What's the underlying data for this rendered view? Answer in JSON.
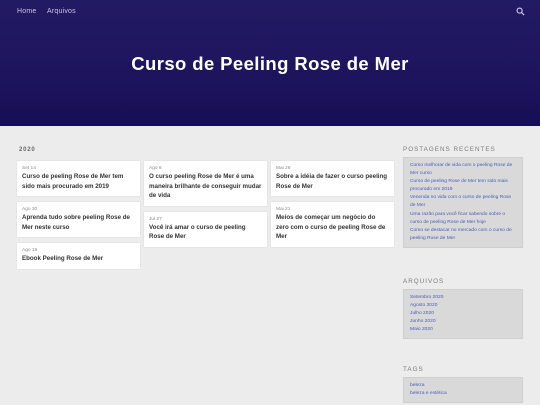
{
  "nav": {
    "home": "Home",
    "archives": "Arquivos",
    "search_icon": "search-icon"
  },
  "hero": {
    "title": "Curso de Peeling Rose de Mer"
  },
  "main": {
    "year": "2020",
    "columns": [
      [
        {
          "date": "Set 14",
          "title": "Curso de peeling Rose de Mer tem sido mais procurado em 2019"
        },
        {
          "date": "Ago 30",
          "title": "Aprenda tudo sobre peeling Rose de Mer neste curso"
        },
        {
          "date": "Ago 19",
          "title": "Ebook Peeling Rose de Mer"
        }
      ],
      [
        {
          "date": "Ago 6",
          "title": "O curso peeling Rose de Mer é uma maneira brilhante de conseguir mudar de vida"
        },
        {
          "date": "Jul 27",
          "title": "Você irá amar o curso de peeling Rose de Mer"
        }
      ],
      [
        {
          "date": "Mai 26",
          "title": "Sobre a idéia de fazer o curso peeling Rose de Mer"
        },
        {
          "date": "Mai 21",
          "title": "Meios de começar um negócio do zero com o curso de peeling Rose de Mer"
        }
      ]
    ]
  },
  "sidebar": {
    "recent": {
      "title": "POSTAGENS RECENTES",
      "links": [
        "Como melhorar de vida com o peeling Rose de Mer curso",
        "Curso de peeling Rose de Mer tem sido mais procurado em 2019",
        "Venenda no vida com o curso de peeling Rose de Mer",
        "Uma razão para você ficar sabendo sobre o curso de peeling Rose de Mer hoje",
        "Como se destacar no mercado com o curso de peeling Rose de Mer"
      ]
    },
    "archives": {
      "title": "ARQUIVOS",
      "links": [
        "Setembro 2020",
        "Agosto 2020",
        "Julho 2020",
        "Junho 2020",
        "Maio 2020"
      ]
    },
    "tags": {
      "title": "TAGS",
      "links": [
        "beleza",
        "beleza e estética"
      ]
    }
  },
  "colors": {
    "hero": "#1f1660",
    "link": "#4b5bb4",
    "background": "#ececec"
  }
}
